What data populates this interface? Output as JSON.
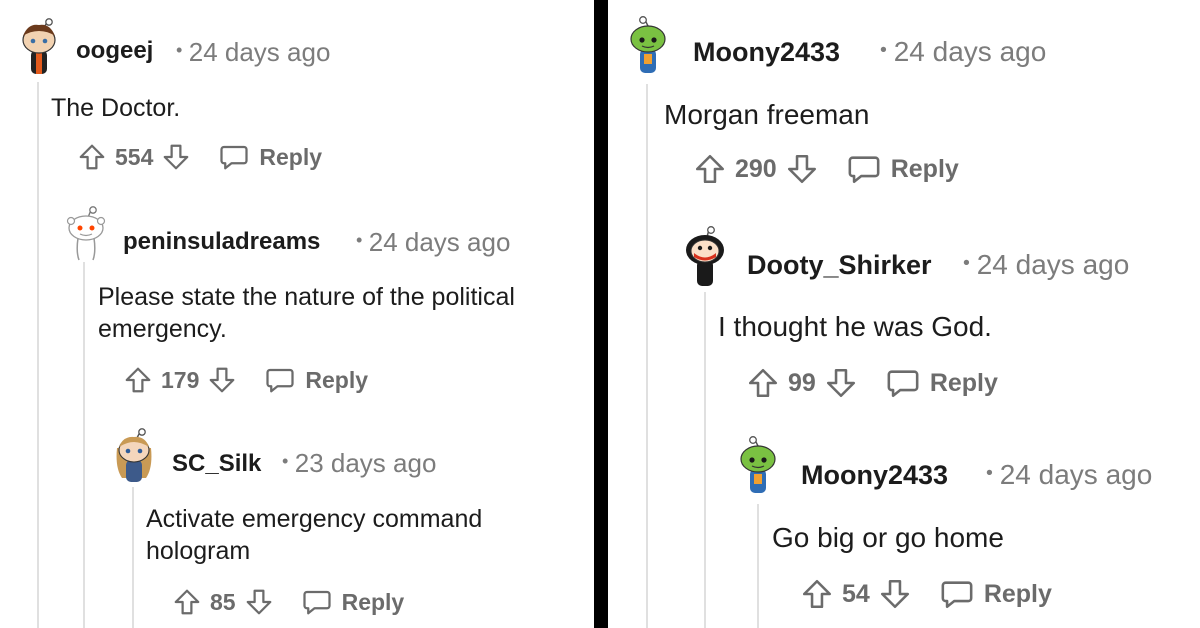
{
  "comments": {
    "left": [
      {
        "username": "oogeej",
        "time": "24 days ago",
        "body": [
          "The Doctor."
        ],
        "votes": "554",
        "reply": "Reply"
      },
      {
        "username": "peninsuladreams",
        "time": "24 days ago",
        "body": [
          "Please state the nature of the political",
          "emergency."
        ],
        "votes": "179",
        "reply": "Reply"
      },
      {
        "username": "SC_Silk",
        "time": "23 days ago",
        "body": [
          "Activate emergency command",
          "hologram"
        ],
        "votes": "85",
        "reply": "Reply"
      }
    ],
    "right": [
      {
        "username": "Moony2433",
        "time": "24 days ago",
        "body": [
          "Morgan freeman"
        ],
        "votes": "290",
        "reply": "Reply"
      },
      {
        "username": "Dooty_Shirker",
        "time": "24 days ago",
        "body": [
          "I thought he was God."
        ],
        "votes": "99",
        "reply": "Reply"
      },
      {
        "username": "Moony2433",
        "time": "24 days ago",
        "body": [
          "Go big or go home"
        ],
        "votes": "54",
        "reply": "Reply"
      }
    ]
  },
  "colors": {
    "text": "#1c1c1c",
    "meta": "#7c7c7c",
    "actions": "#6b6b6b",
    "thread_line": "#e0e0e0",
    "divider": "#000000"
  },
  "icons": [
    "upvote-icon",
    "downvote-icon",
    "comment-icon",
    "snoo-avatar-icon"
  ]
}
